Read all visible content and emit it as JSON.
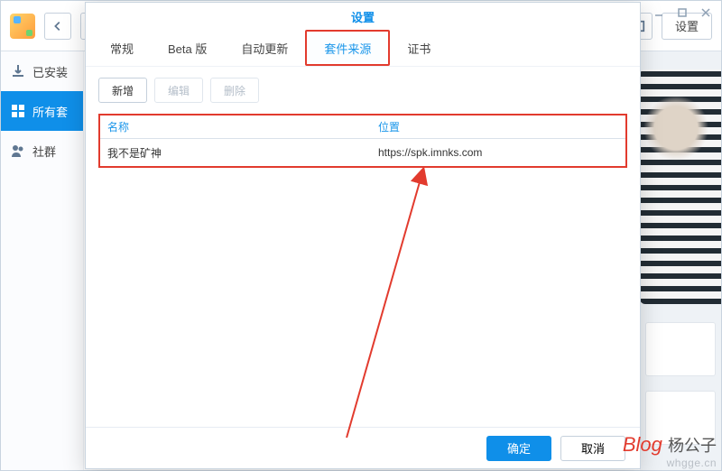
{
  "background": {
    "settings_button": "设置",
    "winctrl": {
      "min": "minimize",
      "max": "maximize",
      "close": "close"
    },
    "sidebar": {
      "installed": "已安装",
      "all": "所有套",
      "community": "社群"
    }
  },
  "modal": {
    "title": "设置",
    "tabs": {
      "general": "常规",
      "beta": "Beta 版",
      "auto_update": "自动更新",
      "sources": "套件来源",
      "cert": "证书"
    },
    "toolbar": {
      "add": "新增",
      "edit": "编辑",
      "delete": "删除"
    },
    "columns": {
      "name": "名称",
      "location": "位置"
    },
    "rows": [
      {
        "name": "我不是矿神",
        "location": "https://spk.imnks.com"
      }
    ],
    "footer": {
      "ok": "确定",
      "cancel": "取消"
    }
  },
  "watermark": {
    "line1_brand": "Blog",
    "line1_name": "杨公子",
    "line2": "whgge.cn"
  }
}
